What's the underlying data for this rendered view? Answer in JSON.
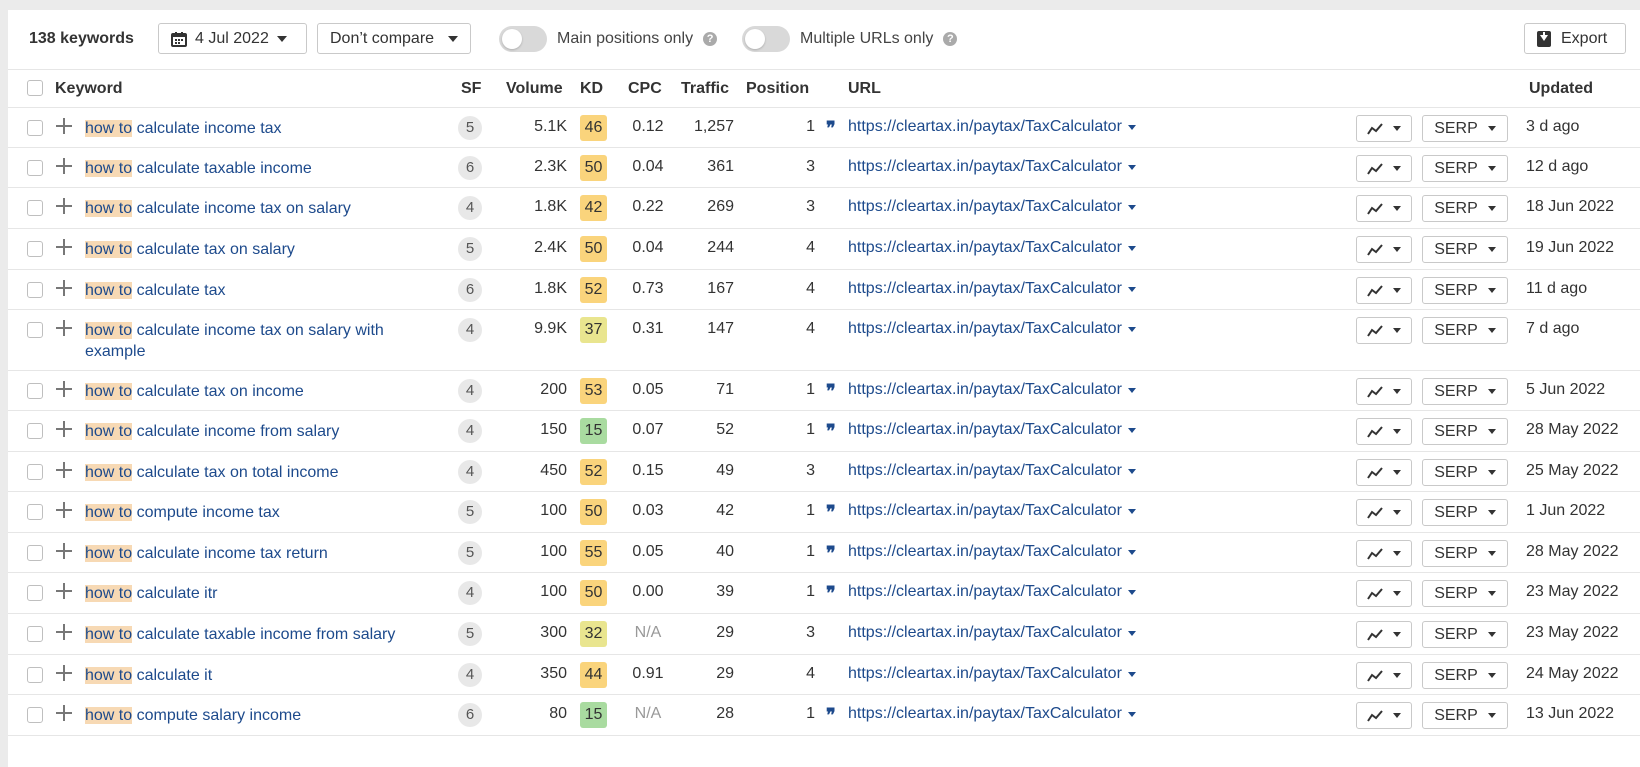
{
  "toolbar": {
    "keyword_count": "138 keywords",
    "date": "4 Jul 2022",
    "compare": "Don’t compare",
    "main_positions_label": "Main positions only",
    "multiple_urls_label": "Multiple URLs only",
    "help_glyph": "?",
    "export_label": "Export"
  },
  "columns": {
    "keyword": "Keyword",
    "sf": "SF",
    "volume": "Volume",
    "kd": "KD",
    "cpc": "CPC",
    "traffic": "Traffic",
    "position": "Position",
    "url": "URL",
    "updated": "Updated"
  },
  "kd_colors": {
    "easy": "#a9dba0",
    "medium": "#e9e58f",
    "hard": "#fad47c"
  },
  "serp_label": "SERP",
  "rows": [
    {
      "kw_hl": "how to",
      "kw_rest": " calculate income tax",
      "sf": "5",
      "volume": "5.1K",
      "kd": "46",
      "kd_level": "hard",
      "cpc": "0.12",
      "traffic": "1,257",
      "position": "1",
      "featured": true,
      "url": "https://cleartax.in/paytax/TaxCalculator",
      "updated": "3 d ago"
    },
    {
      "kw_hl": "how to",
      "kw_rest": " calculate taxable income",
      "sf": "6",
      "volume": "2.3K",
      "kd": "50",
      "kd_level": "hard",
      "cpc": "0.04",
      "traffic": "361",
      "position": "3",
      "featured": false,
      "url": "https://cleartax.in/paytax/TaxCalculator",
      "updated": "12 d ago"
    },
    {
      "kw_hl": "how to",
      "kw_rest": " calculate income tax on salary",
      "sf": "4",
      "volume": "1.8K",
      "kd": "42",
      "kd_level": "hard",
      "cpc": "0.22",
      "traffic": "269",
      "position": "3",
      "featured": false,
      "url": "https://cleartax.in/paytax/TaxCalculator",
      "updated": "18 Jun 2022"
    },
    {
      "kw_hl": "how to",
      "kw_rest": " calculate tax on salary",
      "sf": "5",
      "volume": "2.4K",
      "kd": "50",
      "kd_level": "hard",
      "cpc": "0.04",
      "traffic": "244",
      "position": "4",
      "featured": false,
      "url": "https://cleartax.in/paytax/TaxCalculator",
      "updated": "19 Jun 2022"
    },
    {
      "kw_hl": "how to",
      "kw_rest": " calculate tax",
      "sf": "6",
      "volume": "1.8K",
      "kd": "52",
      "kd_level": "hard",
      "cpc": "0.73",
      "traffic": "167",
      "position": "4",
      "featured": false,
      "url": "https://cleartax.in/paytax/TaxCalculator",
      "updated": "11 d ago"
    },
    {
      "kw_hl": "how to",
      "kw_rest": " calculate income tax on salary with example",
      "sf": "4",
      "volume": "9.9K",
      "kd": "37",
      "kd_level": "medium",
      "cpc": "0.31",
      "traffic": "147",
      "position": "4",
      "featured": false,
      "url": "https://cleartax.in/paytax/TaxCalculator",
      "updated": "7 d ago"
    },
    {
      "kw_hl": "how to",
      "kw_rest": " calculate tax on income",
      "sf": "4",
      "volume": "200",
      "kd": "53",
      "kd_level": "hard",
      "cpc": "0.05",
      "traffic": "71",
      "position": "1",
      "featured": true,
      "url": "https://cleartax.in/paytax/TaxCalculator",
      "updated": "5 Jun 2022"
    },
    {
      "kw_hl": "how to",
      "kw_rest": " calculate income from salary",
      "sf": "4",
      "volume": "150",
      "kd": "15",
      "kd_level": "easy",
      "cpc": "0.07",
      "traffic": "52",
      "position": "1",
      "featured": true,
      "url": "https://cleartax.in/paytax/TaxCalculator",
      "updated": "28 May 2022"
    },
    {
      "kw_hl": "how to",
      "kw_rest": " calculate tax on total income",
      "sf": "4",
      "volume": "450",
      "kd": "52",
      "kd_level": "hard",
      "cpc": "0.15",
      "traffic": "49",
      "position": "3",
      "featured": false,
      "url": "https://cleartax.in/paytax/TaxCalculator",
      "updated": "25 May 2022"
    },
    {
      "kw_hl": "how to",
      "kw_rest": " compute income tax",
      "sf": "5",
      "volume": "100",
      "kd": "50",
      "kd_level": "hard",
      "cpc": "0.03",
      "traffic": "42",
      "position": "1",
      "featured": true,
      "url": "https://cleartax.in/paytax/TaxCalculator",
      "updated": "1 Jun 2022"
    },
    {
      "kw_hl": "how to",
      "kw_rest": " calculate income tax return",
      "sf": "5",
      "volume": "100",
      "kd": "55",
      "kd_level": "hard",
      "cpc": "0.05",
      "traffic": "40",
      "position": "1",
      "featured": true,
      "url": "https://cleartax.in/paytax/TaxCalculator",
      "updated": "28 May 2022"
    },
    {
      "kw_hl": "how to",
      "kw_rest": " calculate itr",
      "sf": "4",
      "volume": "100",
      "kd": "50",
      "kd_level": "hard",
      "cpc": "0.00",
      "traffic": "39",
      "position": "1",
      "featured": true,
      "url": "https://cleartax.in/paytax/TaxCalculator",
      "updated": "23 May 2022"
    },
    {
      "kw_hl": "how to",
      "kw_rest": " calculate taxable income from salary",
      "sf": "5",
      "volume": "300",
      "kd": "32",
      "kd_level": "medium",
      "cpc": "N/A",
      "traffic": "29",
      "position": "3",
      "featured": false,
      "url": "https://cleartax.in/paytax/TaxCalculator",
      "updated": "23 May 2022"
    },
    {
      "kw_hl": "how to",
      "kw_rest": " calculate it",
      "sf": "4",
      "volume": "350",
      "kd": "44",
      "kd_level": "hard",
      "cpc": "0.91",
      "traffic": "29",
      "position": "4",
      "featured": false,
      "url": "https://cleartax.in/paytax/TaxCalculator",
      "updated": "24 May 2022"
    },
    {
      "kw_hl": "how to",
      "kw_rest": " compute salary income",
      "sf": "6",
      "volume": "80",
      "kd": "15",
      "kd_level": "easy",
      "cpc": "N/A",
      "traffic": "28",
      "position": "1",
      "featured": true,
      "url": "https://cleartax.in/paytax/TaxCalculator",
      "updated": "13 Jun 2022"
    }
  ]
}
